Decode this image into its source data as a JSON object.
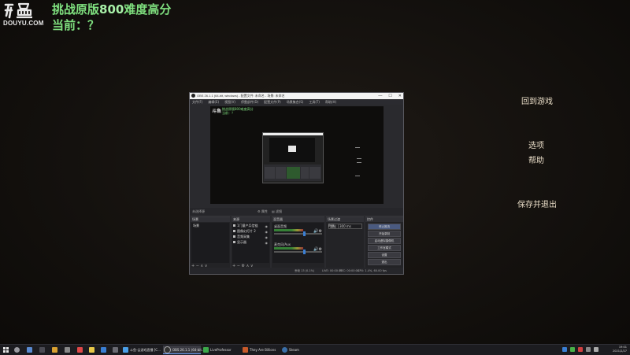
{
  "watermark": {
    "brand": "DOUYU.COM"
  },
  "stream": {
    "title_prefix": "挑战原版",
    "title_highlight": "800",
    "title_suffix": "难度高分",
    "line2": "当前：？"
  },
  "game_menu": [
    {
      "label": "回到游戏"
    },
    {
      "label": "选项"
    },
    {
      "label": "帮助"
    },
    {
      "label": "保存并退出"
    }
  ],
  "obs": {
    "title": "OBS 26.1.1 (64-bit, windows) - 配置文件: 未命名 - 场景: 未命名",
    "controls": {
      "minimize": "—",
      "maximize": "☐",
      "close": "✕"
    },
    "menu": [
      "文件(F)",
      "编辑(E)",
      "视图(V)",
      "停靠部件(D)",
      "配置文件(P)",
      "场景集合(S)",
      "工具(T)",
      "帮助(H)"
    ],
    "preview": {
      "logo": "斗鱼",
      "line1": "挑战原版800难度高分",
      "line2": "当前：？"
    },
    "scene_bar": {
      "left": "未选择源",
      "props": "⚙ 属性",
      "filters": "▤ 滤镜"
    },
    "docks": {
      "scenes": {
        "header": "场景",
        "items": [
          "场景"
        ],
        "footer": "+ − ∧ ∨"
      },
      "sources": {
        "header": "来源",
        "items": [
          "1门量产兵信链",
          "图像幻灯片 2",
          "音频采集",
          "显示器"
        ],
        "footer": "+ − ⚙ ∧ ∨"
      },
      "mixer": {
        "header": "混音器",
        "channels": [
          {
            "name": "桌面音频",
            "level": 0.6
          },
          {
            "name": "麦克风/Aux",
            "level": 0.6
          }
        ]
      },
      "transitions": {
        "header": "场景过渡",
        "type": "淡出",
        "duration_label": "时长",
        "duration": "300 ms"
      },
      "controls": {
        "header": "控件",
        "buttons": [
          "停止推流",
          "开始录制",
          "启动虚拟摄像机",
          "工作室模式",
          "设置",
          "退出"
        ]
      }
    },
    "status": {
      "dropped": "丢帧 13 (0.1%)",
      "live": "LIVE: 00:00:13",
      "rec": "REC: 00:00:00",
      "cpu": "CPU: 1.4%, 60.00 fps"
    }
  },
  "taskbar": {
    "tasks": [
      {
        "label": "斗鱼-云游戏直播 [C...",
        "color": "#4a9fe8"
      },
      {
        "label": "OBS 26.1.1 (64-bit...",
        "color": "#333333"
      },
      {
        "label": "LiveProfessor",
        "color": "#3ca84a"
      },
      {
        "label": "They Are Billions",
        "color": "#c85a2a"
      },
      {
        "label": "Steam",
        "color": "#3a6fa8"
      }
    ],
    "clock": {
      "time": "19:01",
      "date": "2021/2/27"
    }
  }
}
